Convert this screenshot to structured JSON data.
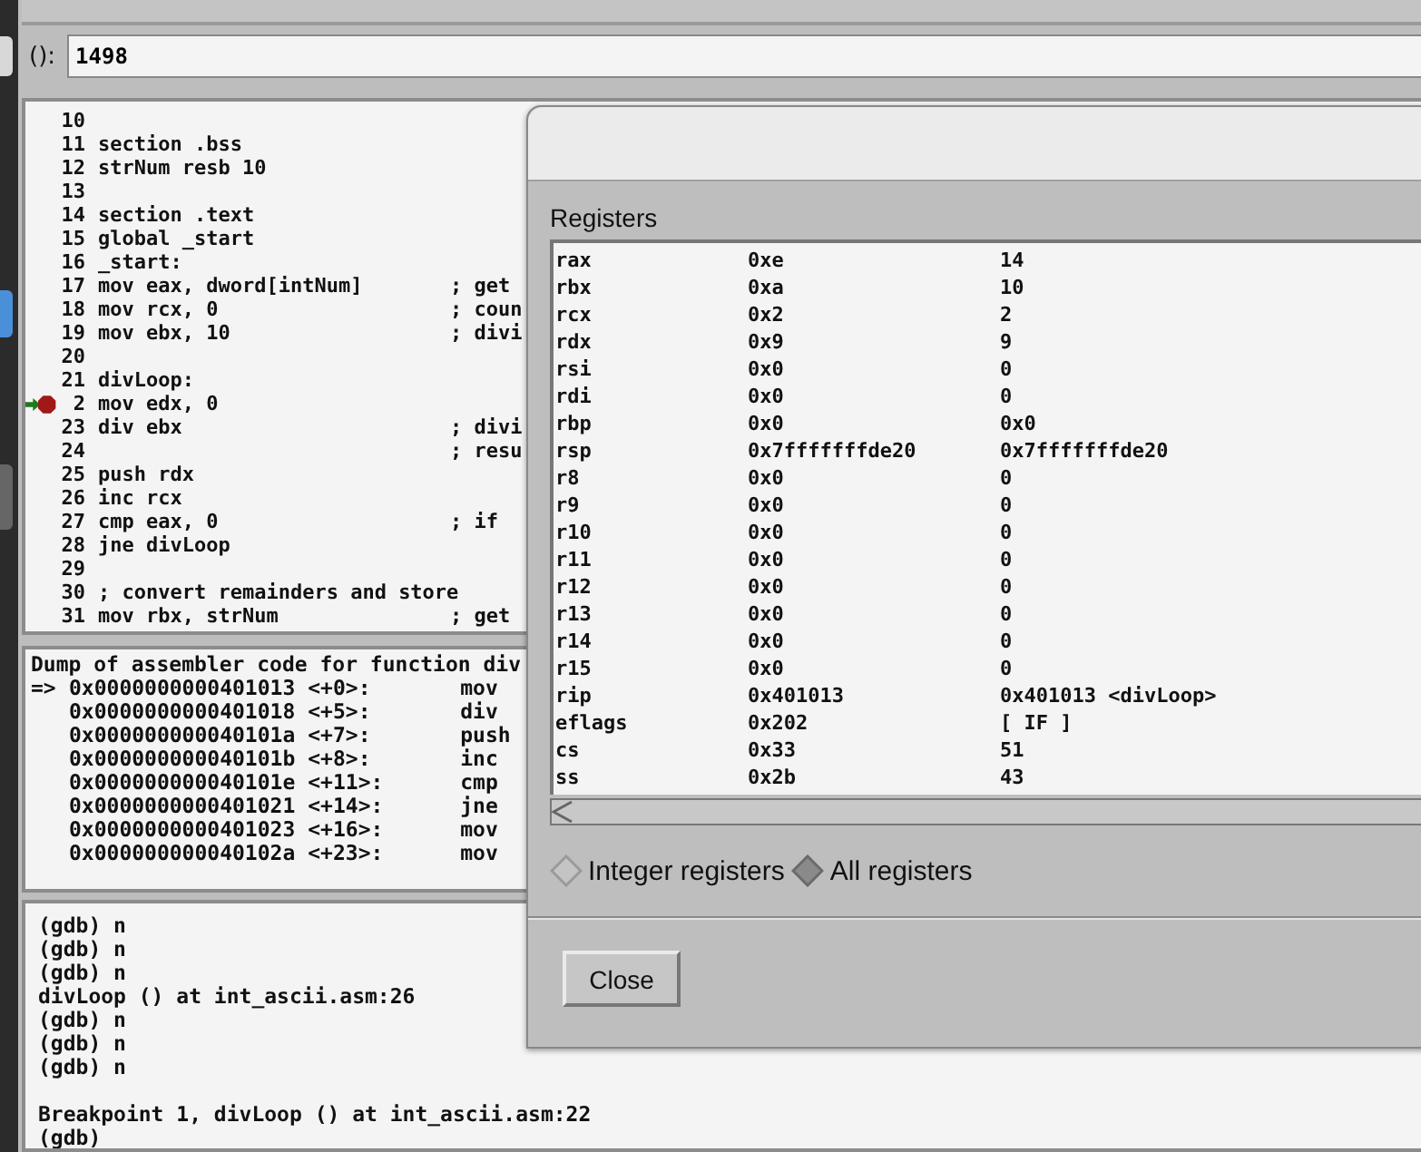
{
  "argument_bar": {
    "label": "():",
    "value": "1498"
  },
  "source": {
    "lines": [
      {
        "num": "10",
        "current": false,
        "breakpoint": false
      },
      {
        "num": "11",
        "code": "section .bss",
        "current": false,
        "breakpoint": false
      },
      {
        "num": "12",
        "code": "strNum resb 10",
        "current": false,
        "breakpoint": false
      },
      {
        "num": "13",
        "current": false,
        "breakpoint": false
      },
      {
        "num": "14",
        "code": "section .text",
        "current": false,
        "breakpoint": false
      },
      {
        "num": "15",
        "code": "global _start",
        "current": false,
        "breakpoint": false
      },
      {
        "num": "16",
        "code": "_start:",
        "current": false,
        "breakpoint": false
      },
      {
        "num": "17",
        "code": "mov eax, dword[intNum]",
        "comment": "; get",
        "current": false,
        "breakpoint": false
      },
      {
        "num": "18",
        "code": "mov rcx, 0",
        "comment": "; coun",
        "current": false,
        "breakpoint": false
      },
      {
        "num": "19",
        "code": "mov ebx, 10",
        "comment": "; divi",
        "current": false,
        "breakpoint": false
      },
      {
        "num": "20",
        "current": false,
        "breakpoint": false
      },
      {
        "num": "21",
        "code": "divLoop:",
        "current": false,
        "breakpoint": false
      },
      {
        "num": "2",
        "code": "mov edx, 0",
        "current": true,
        "breakpoint": true
      },
      {
        "num": "23",
        "code": "div ebx",
        "comment": "; divi",
        "current": false,
        "breakpoint": false
      },
      {
        "num": "24",
        "comment": "; resu",
        "current": false,
        "breakpoint": false
      },
      {
        "num": "25",
        "code": "push rdx",
        "current": false,
        "breakpoint": false
      },
      {
        "num": "26",
        "code": "inc rcx",
        "current": false,
        "breakpoint": false
      },
      {
        "num": "27",
        "code": "cmp eax, 0",
        "comment": "; if",
        "current": false,
        "breakpoint": false
      },
      {
        "num": "28",
        "code": "jne divLoop",
        "current": false,
        "breakpoint": false
      },
      {
        "num": "29",
        "current": false,
        "breakpoint": false
      },
      {
        "num": "30",
        "code": "; convert remainders and store",
        "current": false,
        "breakpoint": false
      },
      {
        "num": "31",
        "code": "mov rbx, strNum",
        "comment": "; get",
        "current": false,
        "breakpoint": false
      }
    ]
  },
  "disassembly": {
    "header": "Dump of assembler code for function div",
    "rows": [
      {
        "marker": "=>",
        "address": "0x0000000000401013",
        "offset": "<+0>:",
        "instruction": "mov"
      },
      {
        "address": "0x0000000000401018",
        "offset": "<+5>:",
        "instruction": "div"
      },
      {
        "address": "0x000000000040101a",
        "offset": "<+7>:",
        "instruction": "push"
      },
      {
        "address": "0x000000000040101b",
        "offset": "<+8>:",
        "instruction": "inc"
      },
      {
        "address": "0x000000000040101e",
        "offset": "<+11>:",
        "instruction": "cmp"
      },
      {
        "address": "0x0000000000401021",
        "offset": "<+14>:",
        "instruction": "jne"
      },
      {
        "address": "0x0000000000401023",
        "offset": "<+16>:",
        "instruction": "mov"
      },
      {
        "address": "0x000000000040102a",
        "offset": "<+23>:",
        "instruction": "mov"
      }
    ]
  },
  "console": {
    "lines": [
      {
        "text": "(gdb) n",
        "blank_line_before": false
      },
      {
        "text": "(gdb) n",
        "blank_line_before": false
      },
      {
        "text": "(gdb) n",
        "blank_line_before": false
      },
      {
        "text": "divLoop () at int_ascii.asm:26",
        "blank_line_before": false
      },
      {
        "text": "(gdb) n",
        "blank_line_before": false
      },
      {
        "text": "(gdb) n",
        "blank_line_before": false
      },
      {
        "text": "(gdb) n",
        "blank_line_before": false
      },
      {
        "text": "Breakpoint 1, divLoop () at int_ascii.asm:22",
        "blank_line_before": true
      },
      {
        "text": "(gdb)",
        "blank_line_before": false
      }
    ]
  },
  "registers_dialog": {
    "title": "Registers",
    "rows": [
      {
        "name": "rax",
        "hex": "0xe",
        "natural": "14"
      },
      {
        "name": "rbx",
        "hex": "0xa",
        "natural": "10"
      },
      {
        "name": "rcx",
        "hex": "0x2",
        "natural": "2"
      },
      {
        "name": "rdx",
        "hex": "0x9",
        "natural": "9"
      },
      {
        "name": "rsi",
        "hex": "0x0",
        "natural": "0"
      },
      {
        "name": "rdi",
        "hex": "0x0",
        "natural": "0"
      },
      {
        "name": "rbp",
        "hex": "0x0",
        "natural": "0x0"
      },
      {
        "name": "rsp",
        "hex": "0x7fffffffde20",
        "natural": "0x7fffffffde20"
      },
      {
        "name": "r8",
        "hex": "0x0",
        "natural": "0"
      },
      {
        "name": "r9",
        "hex": "0x0",
        "natural": "0"
      },
      {
        "name": "r10",
        "hex": "0x0",
        "natural": "0"
      },
      {
        "name": "r11",
        "hex": "0x0",
        "natural": "0"
      },
      {
        "name": "r12",
        "hex": "0x0",
        "natural": "0"
      },
      {
        "name": "r13",
        "hex": "0x0",
        "natural": "0"
      },
      {
        "name": "r14",
        "hex": "0x0",
        "natural": "0"
      },
      {
        "name": "r15",
        "hex": "0x0",
        "natural": "0"
      },
      {
        "name": "rip",
        "hex": "0x401013",
        "natural": "0x401013 <divLoop>"
      },
      {
        "name": "eflags",
        "hex": "0x202",
        "natural": "[ IF ]"
      },
      {
        "name": "cs",
        "hex": "0x33",
        "natural": "51"
      },
      {
        "name": "ss",
        "hex": "0x2b",
        "natural": "43"
      }
    ],
    "options": [
      {
        "label": "Integer registers",
        "selected": false
      },
      {
        "label": "All registers",
        "selected": true
      }
    ],
    "buttons": [
      "Close"
    ]
  }
}
